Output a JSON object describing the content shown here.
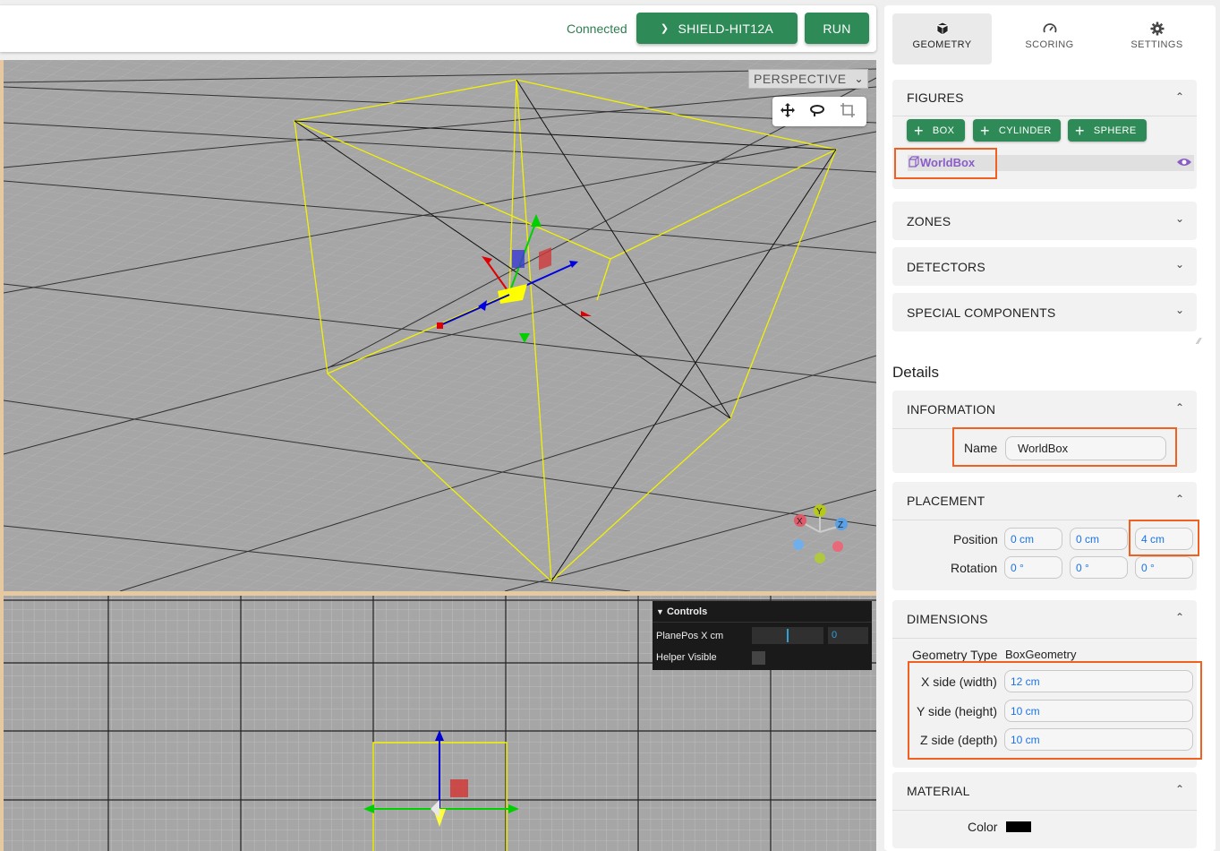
{
  "header": {
    "status": "Connected",
    "device_label": "SHIELD-HIT12A",
    "run_label": "RUN"
  },
  "viewport": {
    "camera_mode": "PERSPECTIVE",
    "toolbox_icons": [
      "move-icon",
      "rotate-icon",
      "scale-icon"
    ],
    "axes_labels": [
      "X",
      "Y",
      "Z"
    ]
  },
  "controls": {
    "title": "Controls",
    "planepos_label": "PlanePos X cm",
    "planepos_value": "0",
    "planepos_fraction": 0.5,
    "helper_label": "Helper Visible",
    "helper_checked": false
  },
  "tabs": [
    {
      "label": "GEOMETRY",
      "icon": "cube-icon",
      "active": true
    },
    {
      "label": "SCORING",
      "icon": "gauge-icon",
      "active": false
    },
    {
      "label": "SETTINGS",
      "icon": "gear-icon",
      "active": false
    }
  ],
  "figures": {
    "title": "FIGURES",
    "buttons": [
      "BOX",
      "CYLINDER",
      "SPHERE"
    ],
    "items": [
      {
        "name": "WorldBox",
        "visible": true
      }
    ]
  },
  "sections": {
    "zones": "ZONES",
    "detectors": "DETECTORS",
    "special": "SPECIAL COMPONENTS"
  },
  "details": {
    "heading": "Details",
    "information": {
      "title": "INFORMATION",
      "name_label": "Name",
      "name_value": "WorldBox"
    },
    "placement": {
      "title": "PLACEMENT",
      "position_label": "Position",
      "position": [
        "0 cm",
        "0 cm",
        "4 cm"
      ],
      "rotation_label": "Rotation",
      "rotation": [
        "0 °",
        "0 °",
        "0 °"
      ]
    },
    "dimensions": {
      "title": "DIMENSIONS",
      "type_label": "Geometry Type",
      "type_value": "BoxGeometry",
      "x_label": "X side (width)",
      "x_value": "12 cm",
      "y_label": "Y side (height)",
      "y_value": "10 cm",
      "z_label": "Z side (depth)",
      "z_value": "10 cm"
    },
    "material": {
      "title": "MATERIAL",
      "color_label": "Color",
      "color_value": "#000000"
    }
  },
  "colors": {
    "accent_green": "#2e8b57",
    "highlight_orange": "#f06020",
    "box_outline": "#ffff00",
    "figure_purple": "#8a5cc8"
  }
}
